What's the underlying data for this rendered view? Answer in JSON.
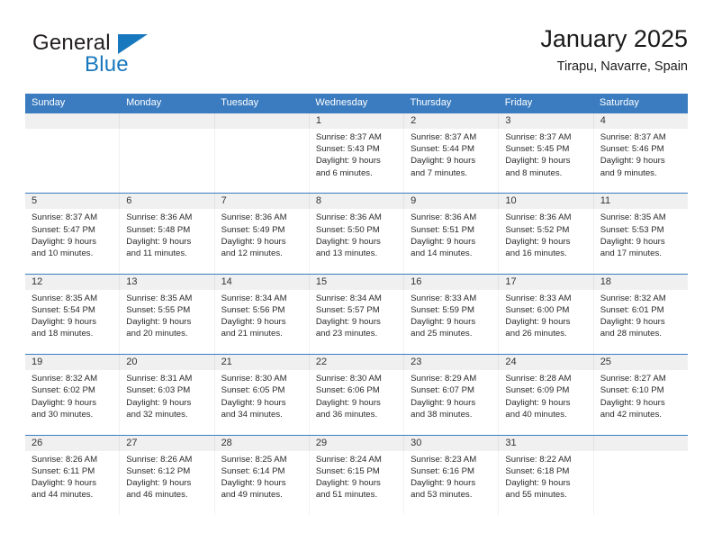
{
  "brand": {
    "name_part1": "General",
    "name_part2": "Blue"
  },
  "header": {
    "title": "January 2025",
    "location": "Tirapu, Navarre, Spain"
  },
  "colors": {
    "header_blue": "#3b7cc0",
    "brand_blue": "#1878be",
    "date_band": "#f0f0f0"
  },
  "calendar": {
    "weekday_headers": [
      "Sunday",
      "Monday",
      "Tuesday",
      "Wednesday",
      "Thursday",
      "Friday",
      "Saturday"
    ],
    "weeks": [
      [
        {
          "day": "",
          "sunrise": "",
          "sunset": "",
          "daylight_1": "",
          "daylight_2": ""
        },
        {
          "day": "",
          "sunrise": "",
          "sunset": "",
          "daylight_1": "",
          "daylight_2": ""
        },
        {
          "day": "",
          "sunrise": "",
          "sunset": "",
          "daylight_1": "",
          "daylight_2": ""
        },
        {
          "day": "1",
          "sunrise": "Sunrise: 8:37 AM",
          "sunset": "Sunset: 5:43 PM",
          "daylight_1": "Daylight: 9 hours",
          "daylight_2": "and 6 minutes."
        },
        {
          "day": "2",
          "sunrise": "Sunrise: 8:37 AM",
          "sunset": "Sunset: 5:44 PM",
          "daylight_1": "Daylight: 9 hours",
          "daylight_2": "and 7 minutes."
        },
        {
          "day": "3",
          "sunrise": "Sunrise: 8:37 AM",
          "sunset": "Sunset: 5:45 PM",
          "daylight_1": "Daylight: 9 hours",
          "daylight_2": "and 8 minutes."
        },
        {
          "day": "4",
          "sunrise": "Sunrise: 8:37 AM",
          "sunset": "Sunset: 5:46 PM",
          "daylight_1": "Daylight: 9 hours",
          "daylight_2": "and 9 minutes."
        }
      ],
      [
        {
          "day": "5",
          "sunrise": "Sunrise: 8:37 AM",
          "sunset": "Sunset: 5:47 PM",
          "daylight_1": "Daylight: 9 hours",
          "daylight_2": "and 10 minutes."
        },
        {
          "day": "6",
          "sunrise": "Sunrise: 8:36 AM",
          "sunset": "Sunset: 5:48 PM",
          "daylight_1": "Daylight: 9 hours",
          "daylight_2": "and 11 minutes."
        },
        {
          "day": "7",
          "sunrise": "Sunrise: 8:36 AM",
          "sunset": "Sunset: 5:49 PM",
          "daylight_1": "Daylight: 9 hours",
          "daylight_2": "and 12 minutes."
        },
        {
          "day": "8",
          "sunrise": "Sunrise: 8:36 AM",
          "sunset": "Sunset: 5:50 PM",
          "daylight_1": "Daylight: 9 hours",
          "daylight_2": "and 13 minutes."
        },
        {
          "day": "9",
          "sunrise": "Sunrise: 8:36 AM",
          "sunset": "Sunset: 5:51 PM",
          "daylight_1": "Daylight: 9 hours",
          "daylight_2": "and 14 minutes."
        },
        {
          "day": "10",
          "sunrise": "Sunrise: 8:36 AM",
          "sunset": "Sunset: 5:52 PM",
          "daylight_1": "Daylight: 9 hours",
          "daylight_2": "and 16 minutes."
        },
        {
          "day": "11",
          "sunrise": "Sunrise: 8:35 AM",
          "sunset": "Sunset: 5:53 PM",
          "daylight_1": "Daylight: 9 hours",
          "daylight_2": "and 17 minutes."
        }
      ],
      [
        {
          "day": "12",
          "sunrise": "Sunrise: 8:35 AM",
          "sunset": "Sunset: 5:54 PM",
          "daylight_1": "Daylight: 9 hours",
          "daylight_2": "and 18 minutes."
        },
        {
          "day": "13",
          "sunrise": "Sunrise: 8:35 AM",
          "sunset": "Sunset: 5:55 PM",
          "daylight_1": "Daylight: 9 hours",
          "daylight_2": "and 20 minutes."
        },
        {
          "day": "14",
          "sunrise": "Sunrise: 8:34 AM",
          "sunset": "Sunset: 5:56 PM",
          "daylight_1": "Daylight: 9 hours",
          "daylight_2": "and 21 minutes."
        },
        {
          "day": "15",
          "sunrise": "Sunrise: 8:34 AM",
          "sunset": "Sunset: 5:57 PM",
          "daylight_1": "Daylight: 9 hours",
          "daylight_2": "and 23 minutes."
        },
        {
          "day": "16",
          "sunrise": "Sunrise: 8:33 AM",
          "sunset": "Sunset: 5:59 PM",
          "daylight_1": "Daylight: 9 hours",
          "daylight_2": "and 25 minutes."
        },
        {
          "day": "17",
          "sunrise": "Sunrise: 8:33 AM",
          "sunset": "Sunset: 6:00 PM",
          "daylight_1": "Daylight: 9 hours",
          "daylight_2": "and 26 minutes."
        },
        {
          "day": "18",
          "sunrise": "Sunrise: 8:32 AM",
          "sunset": "Sunset: 6:01 PM",
          "daylight_1": "Daylight: 9 hours",
          "daylight_2": "and 28 minutes."
        }
      ],
      [
        {
          "day": "19",
          "sunrise": "Sunrise: 8:32 AM",
          "sunset": "Sunset: 6:02 PM",
          "daylight_1": "Daylight: 9 hours",
          "daylight_2": "and 30 minutes."
        },
        {
          "day": "20",
          "sunrise": "Sunrise: 8:31 AM",
          "sunset": "Sunset: 6:03 PM",
          "daylight_1": "Daylight: 9 hours",
          "daylight_2": "and 32 minutes."
        },
        {
          "day": "21",
          "sunrise": "Sunrise: 8:30 AM",
          "sunset": "Sunset: 6:05 PM",
          "daylight_1": "Daylight: 9 hours",
          "daylight_2": "and 34 minutes."
        },
        {
          "day": "22",
          "sunrise": "Sunrise: 8:30 AM",
          "sunset": "Sunset: 6:06 PM",
          "daylight_1": "Daylight: 9 hours",
          "daylight_2": "and 36 minutes."
        },
        {
          "day": "23",
          "sunrise": "Sunrise: 8:29 AM",
          "sunset": "Sunset: 6:07 PM",
          "daylight_1": "Daylight: 9 hours",
          "daylight_2": "and 38 minutes."
        },
        {
          "day": "24",
          "sunrise": "Sunrise: 8:28 AM",
          "sunset": "Sunset: 6:09 PM",
          "daylight_1": "Daylight: 9 hours",
          "daylight_2": "and 40 minutes."
        },
        {
          "day": "25",
          "sunrise": "Sunrise: 8:27 AM",
          "sunset": "Sunset: 6:10 PM",
          "daylight_1": "Daylight: 9 hours",
          "daylight_2": "and 42 minutes."
        }
      ],
      [
        {
          "day": "26",
          "sunrise": "Sunrise: 8:26 AM",
          "sunset": "Sunset: 6:11 PM",
          "daylight_1": "Daylight: 9 hours",
          "daylight_2": "and 44 minutes."
        },
        {
          "day": "27",
          "sunrise": "Sunrise: 8:26 AM",
          "sunset": "Sunset: 6:12 PM",
          "daylight_1": "Daylight: 9 hours",
          "daylight_2": "and 46 minutes."
        },
        {
          "day": "28",
          "sunrise": "Sunrise: 8:25 AM",
          "sunset": "Sunset: 6:14 PM",
          "daylight_1": "Daylight: 9 hours",
          "daylight_2": "and 49 minutes."
        },
        {
          "day": "29",
          "sunrise": "Sunrise: 8:24 AM",
          "sunset": "Sunset: 6:15 PM",
          "daylight_1": "Daylight: 9 hours",
          "daylight_2": "and 51 minutes."
        },
        {
          "day": "30",
          "sunrise": "Sunrise: 8:23 AM",
          "sunset": "Sunset: 6:16 PM",
          "daylight_1": "Daylight: 9 hours",
          "daylight_2": "and 53 minutes."
        },
        {
          "day": "31",
          "sunrise": "Sunrise: 8:22 AM",
          "sunset": "Sunset: 6:18 PM",
          "daylight_1": "Daylight: 9 hours",
          "daylight_2": "and 55 minutes."
        },
        {
          "day": "",
          "sunrise": "",
          "sunset": "",
          "daylight_1": "",
          "daylight_2": ""
        }
      ]
    ]
  }
}
